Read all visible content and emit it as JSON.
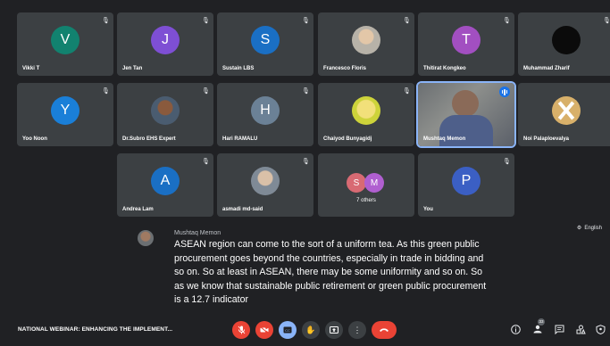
{
  "participants": [
    {
      "name": "Vikki T",
      "initial": "V",
      "color": "#12826f"
    },
    {
      "name": "Jen Tan",
      "initial": "J",
      "color": "#7e4fd4"
    },
    {
      "name": "Sustain LBS",
      "initial": "S",
      "color": "#1a6fc4"
    },
    {
      "name": "Francesco Floris",
      "initial": "",
      "color": "#b7b2a8"
    },
    {
      "name": "Thitirat Kongkeo",
      "initial": "T",
      "color": "#a24fc1"
    },
    {
      "name": "Muhammad Zharif",
      "initial": "",
      "color": "#0b0b0b"
    },
    {
      "name": "Yoo Noon",
      "initial": "Y",
      "color": "#1a7fd8"
    },
    {
      "name": "Dr.Subro EHS Expert",
      "initial": "",
      "color": "#7a5a3d"
    },
    {
      "name": "Hari RAMALU",
      "initial": "H",
      "color": "#6b8196"
    },
    {
      "name": "Chaiyod Bunyagidj",
      "initial": "",
      "color": "#cdd33a"
    },
    {
      "name": "Mushtaq Memon",
      "initial": "",
      "color": "#7a7a7a"
    },
    {
      "name": "Noi Palaploevalya",
      "initial": "",
      "color": "#d8b06a"
    },
    {
      "name": "Andrea Lam",
      "initial": "A",
      "color": "#1a6fc4"
    },
    {
      "name": "asmadi md-said",
      "initial": "",
      "color": "#7f8a96"
    },
    {
      "name": "You",
      "initial": "P",
      "color": "#3b5fc4"
    }
  ],
  "others": {
    "label": "7 others",
    "a1": "S",
    "a1_color": "#d86a73",
    "a2": "M",
    "a2_color": "#b05fd0"
  },
  "captions": {
    "speaker": "Mushtaq Memon",
    "text": "ASEAN region can come to the sort of a uniform tea. As this green public procurement goes beyond the countries, especially in trade in bidding and so on. So at least in ASEAN, there may be some uniformity and so on. So as we know that sustainable public retirement or green public procurement is a 12.7 indicator",
    "language": "English"
  },
  "meeting": {
    "title": "NATIONAL WEBINAR: ENHANCING THE IMPLEMENT..."
  },
  "people_count": "33"
}
